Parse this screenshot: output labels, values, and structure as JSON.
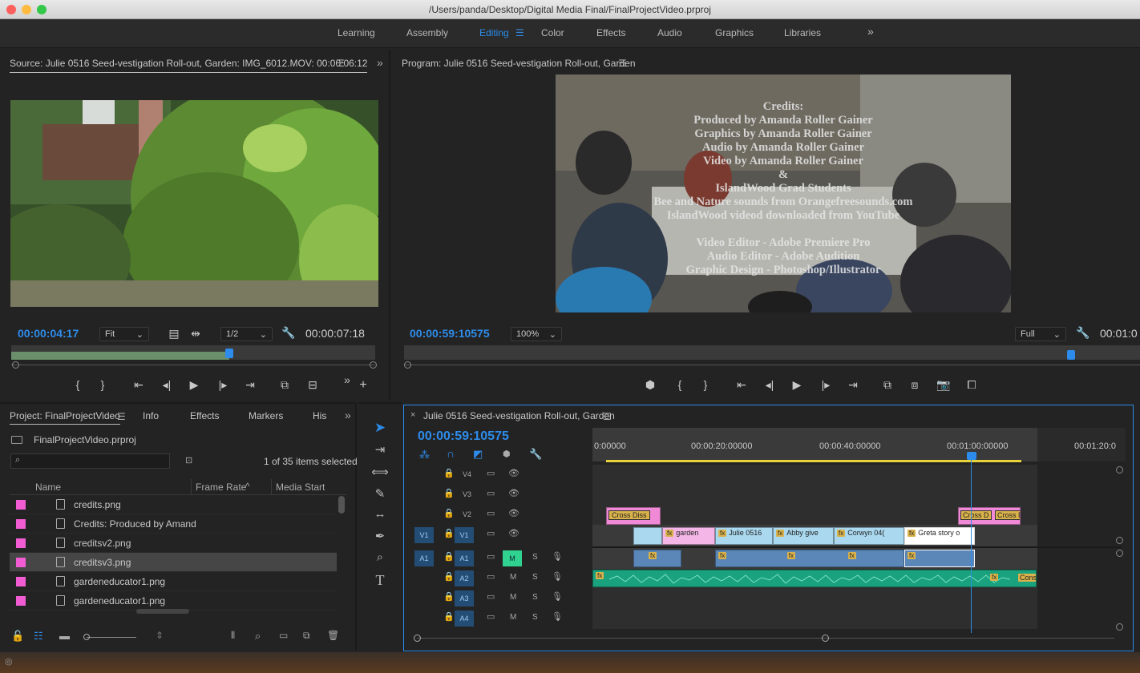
{
  "titlebar": {
    "title": "/Users/panda/Desktop/Digital Media Final/FinalProjectVideo.prproj"
  },
  "workspaces": {
    "items": [
      "Learning",
      "Assembly",
      "Editing",
      "Color",
      "Effects",
      "Audio",
      "Graphics",
      "Libraries"
    ],
    "active": "Editing",
    "more": "»"
  },
  "source": {
    "title": "Source: Julie 0516 Seed-vestigation Roll-out, Garden: IMG_6012.MOV: 00:00:06:12",
    "timecode_in": "00:00:04:17",
    "zoom": "Fit",
    "resolution": "1/2",
    "timecode_out": "00:00:07:18",
    "playhead_fraction": 0.6
  },
  "program": {
    "title": "Program: Julie 0516 Seed-vestigation Roll-out, Garden",
    "timecode": "00:00:59:10575",
    "zoom": "100%",
    "quality": "Full",
    "timecode_out": "00:01:0",
    "credits": [
      "Credits:",
      "Produced by Amanda Roller Gainer",
      "Graphics by Amanda Roller Gainer",
      "Audio by Amanda Roller Gainer",
      "Video by Amanda Roller Gainer",
      "&",
      "IslandWood Grad Students",
      "Bee and Nature sounds from Orangefreesounds.com",
      "IslandWood videod downloaded from YouTube",
      "",
      "Video Editor - Adobe Premiere Pro",
      "Audio Editor - Adobe Audition",
      "Graphic Design - Photoshop/Illustrator"
    ]
  },
  "project": {
    "tabs": [
      "Project: FinalProjectVideo",
      "Info",
      "Effects",
      "Markers",
      "His"
    ],
    "file": "FinalProjectVideo.prproj",
    "selection": "1 of 35 items selected",
    "columns": [
      "Name",
      "Frame Rate",
      "Media Start"
    ],
    "items": [
      "credits.png",
      "Credits: Produced by Amand",
      "creditsv2.png",
      "creditsv3.png",
      "gardeneducator1.png",
      "gardeneducator1.png"
    ],
    "selected_index": 3
  },
  "timeline": {
    "sequence": "Julie 0516 Seed-vestigation Roll-out, Garden",
    "timecode": "00:00:59:10575",
    "ruler": [
      "0:00000",
      "00:00:20:00000",
      "00:00:40:00000",
      "00:01:00:00000",
      "00:01:20:0"
    ],
    "video_tracks": [
      "V4",
      "V3",
      "V2",
      "V1"
    ],
    "audio_tracks": [
      "A1",
      "A2",
      "A3",
      "A4"
    ],
    "source_v": "V1",
    "source_a": "A1",
    "mute": "M",
    "solo": "S",
    "clips": {
      "v2_a": "Cross Diss",
      "v2_b": "Cross D",
      "v2_c": "Cross D",
      "v1_1": "garden",
      "v1_2": "Julie 0516",
      "v1_3": "Abby give",
      "v1_4": "Corwyn 04(",
      "v1_5": "Greta story o",
      "a2_end": "Cons",
      "fx": "fx"
    }
  },
  "colors": {
    "accent": "#2d8ceb",
    "label_pink": "#f25cd3",
    "audio_green": "#1aa27e",
    "video_blue": "#a9d8ef"
  }
}
